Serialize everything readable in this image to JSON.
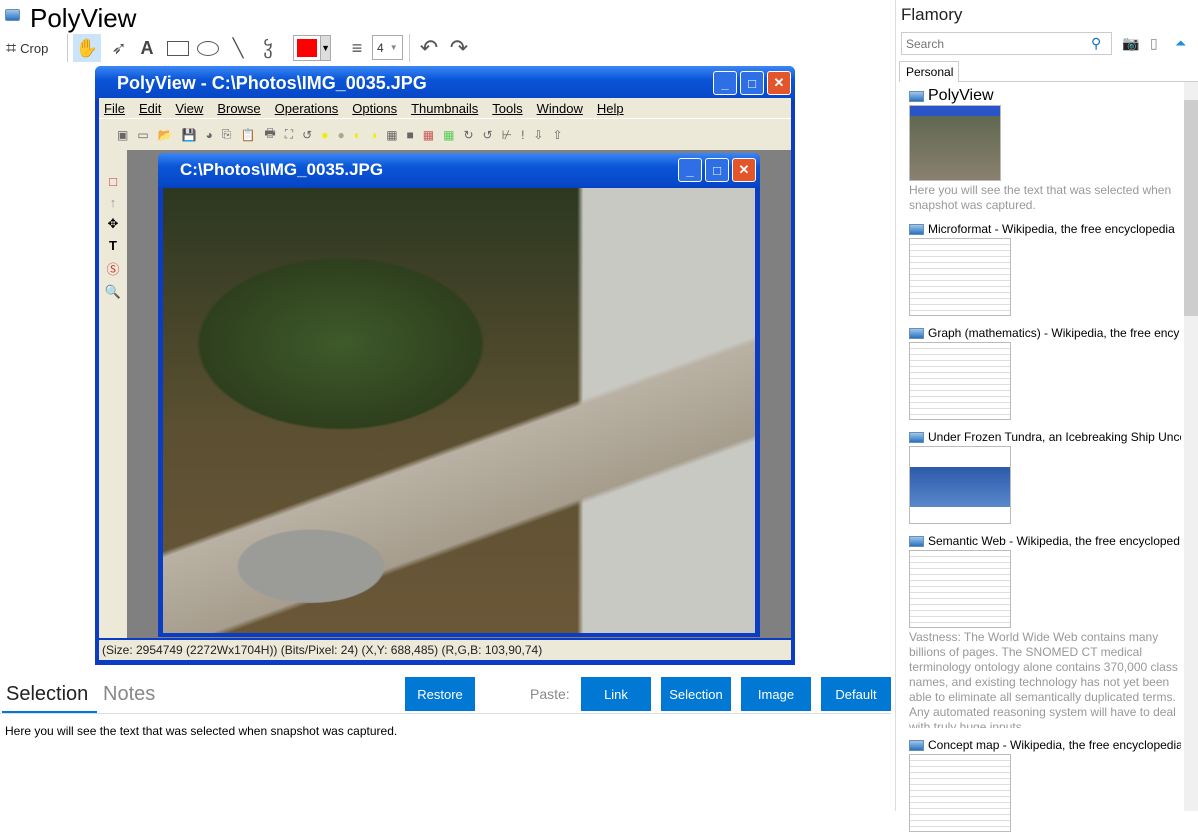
{
  "app": {
    "title": "PolyView"
  },
  "toolbar": {
    "crop_label": "Crop",
    "line_width": "4",
    "color": "#ff0000"
  },
  "snapshot": {
    "main_title": "PolyView - C:\\Photos\\IMG_0035.JPG",
    "menu": [
      "File",
      "Edit",
      "View",
      "Browse",
      "Operations",
      "Options",
      "Thumbnails",
      "Tools",
      "Window",
      "Help"
    ],
    "child_title": "C:\\Photos\\IMG_0035.JPG",
    "status": "(Size: 2954749 (2272Wx1704H)) (Bits/Pixel: 24) (X,Y: 688,485) (R,G,B: 103,90,74)"
  },
  "bottom": {
    "tabs": [
      "Selection",
      "Notes"
    ],
    "restore": "Restore",
    "paste_label": "Paste:",
    "paste_buttons": [
      "Link",
      "Selection",
      "Image",
      "Default"
    ],
    "selection_text": "Here you will see the text that was selected when snapshot was captured."
  },
  "sidebar": {
    "title": "Flamory",
    "search_placeholder": "Search",
    "tab": "Personal",
    "items": [
      {
        "title": "PolyView",
        "desc": "Here you will see the text that was selected when snapshot was captured."
      },
      {
        "title": "Microformat - Wikipedia, the free encyclopedia"
      },
      {
        "title": "Graph (mathematics) - Wikipedia, the free ency"
      },
      {
        "title": "Under Frozen Tundra, an Icebreaking Ship Unco"
      },
      {
        "title": "Semantic Web - Wikipedia, the free encycloped",
        "desc": "Vastness: The World Wide Web contains many billions of pages. The SNOMED CT medical terminology ontology alone contains 370,000 class names, and existing technology has not yet been able to eliminate all semantically duplicated terms. Any automated reasoning system will have to deal with truly huge inputs."
      },
      {
        "title": "Concept map - Wikipedia, the free encyclopedia"
      }
    ]
  }
}
